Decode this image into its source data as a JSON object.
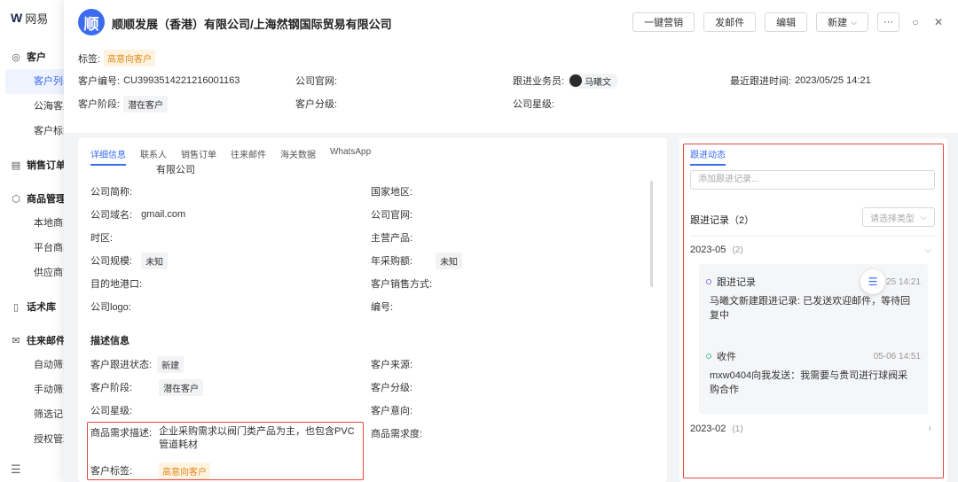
{
  "nav": {
    "logo_text": "网易",
    "groups": [
      {
        "icon": "user-icon",
        "label": "客户",
        "items": [
          "客户列表",
          "公海客户",
          "客户标签"
        ]
      },
      {
        "icon": "doc-icon",
        "label": "销售订单",
        "items": []
      },
      {
        "icon": "box-icon",
        "label": "商品管理",
        "items": [
          "本地商品",
          "平台商品",
          "供应商管"
        ]
      },
      {
        "icon": "script-icon",
        "label": "话术库",
        "items": []
      },
      {
        "icon": "mail-icon",
        "label": "往来邮件",
        "items": [
          "自动筛选",
          "手动筛选",
          "筛选记录",
          "授权管理"
        ]
      }
    ]
  },
  "header": {
    "avatar_char": "顺",
    "company": "顺顺发展（香港）有限公司/上海然钢国际贸易有限公司",
    "buttons": [
      "一键营销",
      "发邮件",
      "编辑",
      "新建"
    ],
    "more": "···"
  },
  "summary": {
    "tag_label": "标签:",
    "tag_value": "高意向客户",
    "customer_no_label": "客户编号:",
    "customer_no": "CU3993514221216001163",
    "website_label": "公司官网:",
    "sales_label": "跟进业务员:",
    "sales_name": "马曦文",
    "last_follow_label": "最近跟进时间:",
    "last_follow": "2023/05/25 14:21",
    "stage_label": "客户阶段:",
    "stage_value": "潜在客户",
    "grade_label": "客户分级:",
    "star_label": "公司星级:"
  },
  "detail": {
    "tabs": [
      "详细信息",
      "联系人",
      "销售订单",
      "往来邮件",
      "海关数据",
      "WhatsApp"
    ],
    "cut_value": "有限公司",
    "fields_left": [
      {
        "label": "公司简称:",
        "value": ""
      },
      {
        "label": "公司域名:",
        "value": "gmail.com"
      },
      {
        "label": "时区:",
        "value": ""
      },
      {
        "label": "公司规模:",
        "value": "未知"
      },
      {
        "label": "目的地港口:",
        "value": ""
      },
      {
        "label": "公司logo:",
        "value": ""
      }
    ],
    "fields_right": [
      {
        "label": "国家地区:",
        "value": ""
      },
      {
        "label": "公司官网:",
        "value": ""
      },
      {
        "label": "主营产品:",
        "value": ""
      },
      {
        "label": "年采购额:",
        "value": "未知"
      },
      {
        "label": "客户销售方式:",
        "value": ""
      },
      {
        "label": "编号:",
        "value": ""
      }
    ],
    "section_title": "描述信息",
    "desc_left": [
      {
        "label": "客户跟进状态:",
        "value": "新建"
      },
      {
        "label": "客户阶段:",
        "value": "潜在客户"
      },
      {
        "label": "公司星级:",
        "value": ""
      }
    ],
    "desc_right": [
      {
        "label": "客户来源:",
        "value": ""
      },
      {
        "label": "客户分级:",
        "value": ""
      },
      {
        "label": "客户意向:",
        "value": ""
      },
      {
        "label": "商品需求度:",
        "value": ""
      }
    ],
    "demand_label": "商品需求描述:",
    "demand_value": "企业采购需求以阀门类产品为主，也包含PVC管道耗材",
    "cust_tag_label": "客户标签:",
    "cust_tag_value": "高意向客户"
  },
  "followup": {
    "tab": "跟进动态",
    "input_placeholder": "添加跟进记录...",
    "records_title": "跟进记录（2）",
    "type_select": "请选择类型",
    "months": [
      {
        "label": "2023-05",
        "count": "(2)"
      },
      {
        "label": "2023-02",
        "count": "(1)"
      }
    ],
    "entries": [
      {
        "type": "跟进记录",
        "time": "05-25 14:21",
        "text": "马曦文新建跟进记录: 已发送欢迎邮件，等待回复中"
      },
      {
        "type": "收件",
        "time": "05-06 14:51",
        "text": "mxw0404向我发送：我需要与贵司进行球阀采购合作"
      }
    ]
  },
  "colors": {
    "accent": "#3b6cf0",
    "highlight_box": "#e8453c",
    "tag_orange": "#e08a1e"
  }
}
